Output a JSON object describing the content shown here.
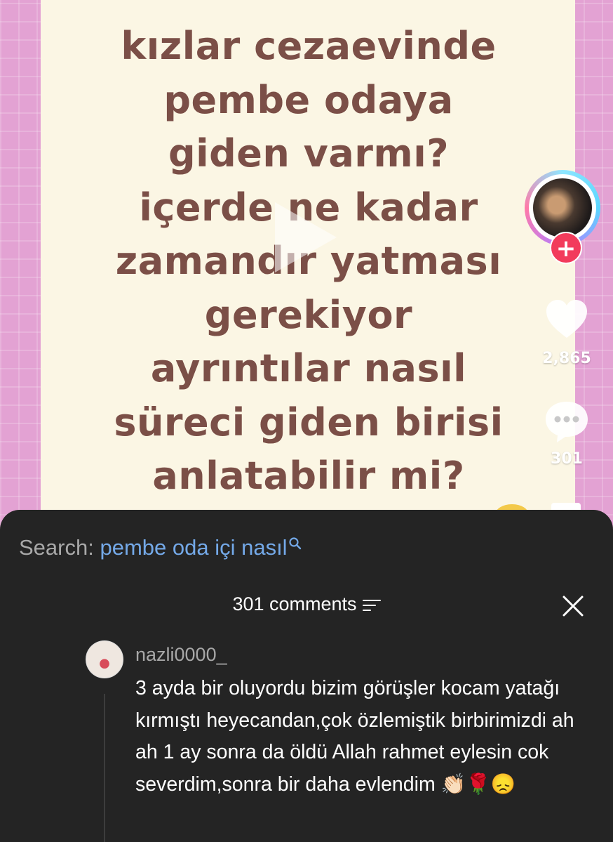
{
  "video": {
    "question_text": "kızlar cezaevinde\npembe odaya\ngiden varmı?\niçerde ne kadar\nzamandır yatması\ngerekiyor\nayrıntılar nasıl\nsüreci giden birisi\nanlatabilir mi?",
    "likes": "2,865",
    "comments": "301",
    "follow_symbol": "+"
  },
  "search": {
    "label": "Search:",
    "query": "pembe oda içi nasıl"
  },
  "comments_panel": {
    "title": "301 comments",
    "items": [
      {
        "username": "nazli0000_",
        "text": "3 ayda bir oluyordu bizim görüşler kocam yatağı kırmıştı heyecandan,çok özlemiştik birbirimizdi ah ah 1 ay sonra da öldü Allah rahmet eylesin cok severdim,sonra bir daha evlendim 👏🏻🌹😞"
      }
    ]
  },
  "icons": {
    "play": "play-icon",
    "like": "heart-icon",
    "comment": "comment-bubble-icon",
    "search": "search-icon",
    "sort": "sort-icon",
    "close": "close-icon"
  },
  "colors": {
    "background_pink": "#e3a2d3",
    "paper": "#fbf6e4",
    "question_text": "#7b4f47",
    "sheet": "#242424",
    "search_query": "#74a9e8",
    "follow": "#f23b5c"
  }
}
